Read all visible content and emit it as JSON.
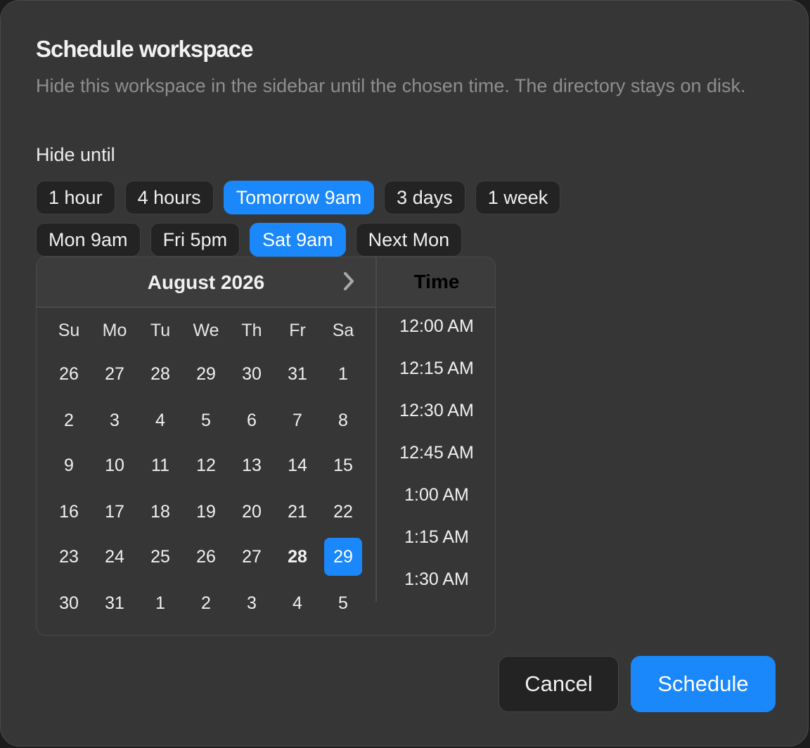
{
  "dialog": {
    "title": "Schedule workspace",
    "description": "Hide this workspace in the sidebar until the chosen time. The directory stays on disk.",
    "hide_label": "Hide until"
  },
  "presets_row1": [
    {
      "label": "1 hour",
      "active": false
    },
    {
      "label": "4 hours",
      "active": false
    },
    {
      "label": "Tomorrow 9am",
      "active": true
    },
    {
      "label": "3 days",
      "active": false
    },
    {
      "label": "1 week",
      "active": false
    }
  ],
  "presets_row2": [
    {
      "label": "Mon 9am",
      "active": false
    },
    {
      "label": "Fri 5pm",
      "active": false
    },
    {
      "label": "Sat 9am",
      "active": true
    },
    {
      "label": "Next Mon",
      "active": false
    }
  ],
  "calendar": {
    "month_label": "August 2026",
    "next_icon": "chevron-right-icon",
    "weekdays": [
      "Su",
      "Mo",
      "Tu",
      "We",
      "Th",
      "Fr",
      "Sa"
    ],
    "weeks": [
      [
        "26",
        "27",
        "28",
        "29",
        "30",
        "31",
        "1"
      ],
      [
        "2",
        "3",
        "4",
        "5",
        "6",
        "7",
        "8"
      ],
      [
        "9",
        "10",
        "11",
        "12",
        "13",
        "14",
        "15"
      ],
      [
        "16",
        "17",
        "18",
        "19",
        "20",
        "21",
        "22"
      ],
      [
        "23",
        "24",
        "25",
        "26",
        "27",
        "28",
        "29"
      ],
      [
        "30",
        "31",
        "1",
        "2",
        "3",
        "4",
        "5"
      ]
    ],
    "today": "28",
    "selected": "29"
  },
  "time": {
    "header": "Time",
    "slots": [
      "12:00 AM",
      "12:15 AM",
      "12:30 AM",
      "12:45 AM",
      "1:00 AM",
      "1:15 AM",
      "1:30 AM"
    ]
  },
  "actions": {
    "cancel_label": "Cancel",
    "schedule_label": "Schedule"
  },
  "colors": {
    "accent": "#1a87fb",
    "dialog_bg": "#363636",
    "chip_bg": "#232323"
  }
}
